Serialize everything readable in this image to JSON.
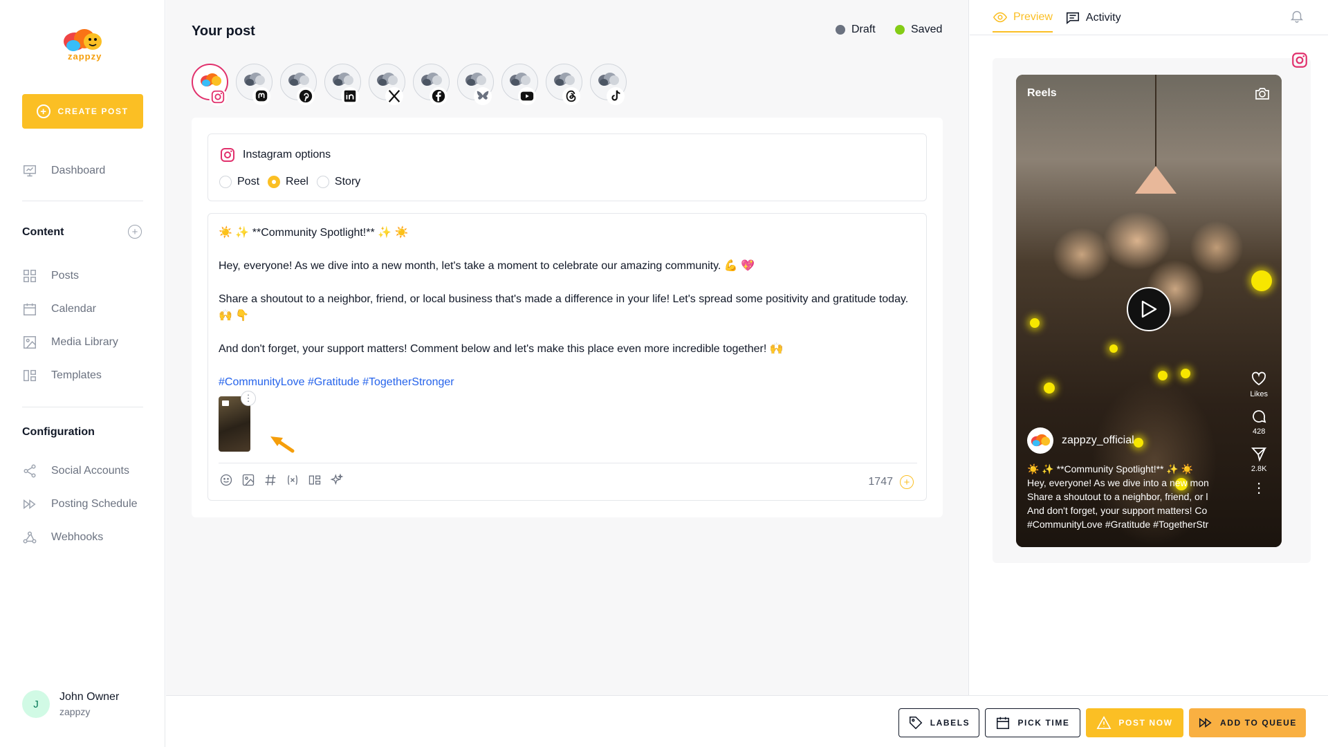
{
  "app": {
    "logo_text": "zappzy"
  },
  "sidebar": {
    "create_post": "CREATE POST",
    "dashboard": "Dashboard",
    "content_title": "Content",
    "content_items": [
      "Posts",
      "Calendar",
      "Media Library",
      "Templates"
    ],
    "configuration_title": "Configuration",
    "configuration_items": [
      "Social Accounts",
      "Posting Schedule",
      "Webhooks"
    ],
    "user": {
      "initial": "J",
      "name": "John Owner",
      "org": "zappzy"
    }
  },
  "main": {
    "title": "Your post",
    "status": [
      {
        "label": "Draft",
        "color": "#6b7280"
      },
      {
        "label": "Saved",
        "color": "#84cc16"
      }
    ],
    "accounts": [
      {
        "network": "instagram",
        "icon": "instagram-icon",
        "active": true
      },
      {
        "network": "mastodon",
        "icon": "mastodon-icon",
        "active": false
      },
      {
        "network": "pinterest",
        "icon": "pinterest-icon",
        "active": false
      },
      {
        "network": "linkedin",
        "icon": "linkedin-icon",
        "active": false
      },
      {
        "network": "x",
        "icon": "x-icon",
        "active": false
      },
      {
        "network": "facebook",
        "icon": "facebook-icon",
        "active": false
      },
      {
        "network": "bluesky",
        "icon": "bluesky-icon",
        "active": false
      },
      {
        "network": "youtube",
        "icon": "youtube-icon",
        "active": false
      },
      {
        "network": "threads",
        "icon": "threads-icon",
        "active": false
      },
      {
        "network": "tiktok",
        "icon": "tiktok-icon",
        "active": false
      }
    ],
    "instagram_options": {
      "title": "Instagram options",
      "types": [
        "Post",
        "Reel",
        "Story"
      ],
      "selected": "Reel"
    },
    "editor": {
      "line1": "☀️ ✨ **Community Spotlight!** ✨ ☀️",
      "line2": "Hey, everyone! As we dive into a new month, let's take a moment to celebrate our amazing community. 💪 💖",
      "line3": "Share a shoutout to a neighbor, friend, or local business that's made a difference in your life! Let's spread some positivity and gratitude today. 🙌 👇",
      "line4": "And don't forget, your support matters! Comment below and let's make this place even more incredible together! 🙌",
      "hashtags": "#CommunityLove #Gratitude #TogetherStronger",
      "char_count": "1747"
    }
  },
  "preview": {
    "tabs": {
      "preview": "Preview",
      "activity": "Activity"
    },
    "reels_label": "Reels",
    "username": "zappzy_official",
    "likes_label": "Likes",
    "comments": "428",
    "shares": "2.8K",
    "caption": [
      "☀️ ✨ **Community Spotlight!** ✨ ☀️",
      "Hey, everyone! As we dive into a new mon",
      "Share a shoutout to a neighbor, friend, or l",
      "And don't forget, your support matters! Co",
      "#CommunityLove #Gratitude #TogetherStr"
    ]
  },
  "bottom": {
    "labels": "LABELS",
    "pick_time": "PICK TIME",
    "post_now": "POST NOW",
    "add_to_queue": "ADD TO QUEUE"
  },
  "colors": {
    "accent": "#fbbf24",
    "instagram": "#e1306c",
    "hashtag": "#2563eb"
  }
}
